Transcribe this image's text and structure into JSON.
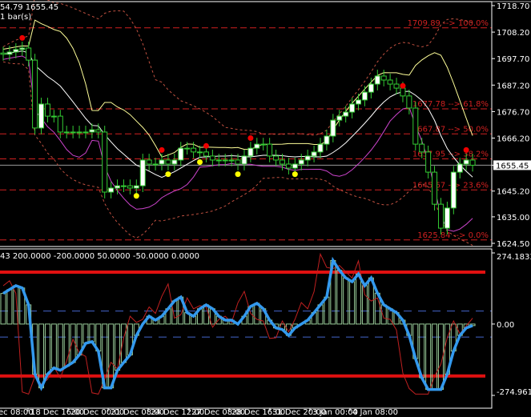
{
  "header": {
    "ohlc_text": "54.79 1655.45",
    "bars_text": "1 bar(s)"
  },
  "indicator_header": {
    "text": "43 200.0000 -200.0000 50.0000 -50.0000 0.0000"
  },
  "colors": {
    "bull_body": "#ffffff",
    "candle_outline": "#33cc33",
    "fib": "#d02020",
    "osc": "#3399ee",
    "level": "#e01010",
    "mid_band": "#ffffff",
    "upper_band": "#ffff99",
    "lower_band": "#cc44cc"
  },
  "chart_data": [
    {
      "type": "candlestick",
      "title": "",
      "ylim": [
        1624.5,
        1718.7
      ],
      "price_ticks": [
        "1718.70",
        "1708.20",
        "1697.70",
        "1687.20",
        "1676.70",
        "1666.20",
        "1655.45",
        "1645.20",
        "1635.00",
        "1624.50"
      ],
      "price_tick_values": [
        1718.7,
        1708.2,
        1697.7,
        1687.2,
        1676.7,
        1666.2,
        1655.45,
        1645.2,
        1635.0,
        1624.5
      ],
      "current_price": "1655.45",
      "closes": [
        1699.4,
        1700.3,
        1701.3,
        1701.9,
        1697.1,
        1670.2,
        1679.7,
        1674.9,
        1674.9,
        1668.6,
        1668.6,
        1668.6,
        1668.6,
        1668.6,
        1669.5,
        1668.6,
        1644.8,
        1646.4,
        1647.3,
        1647.3,
        1646.4,
        1647.3,
        1657.5,
        1655.9,
        1655.9,
        1657.5,
        1655.9,
        1657.5,
        1662.2,
        1662.2,
        1660.7,
        1660.7,
        1659.1,
        1657.5,
        1657.5,
        1657.5,
        1657.5,
        1655.9,
        1659.1,
        1662.2,
        1663.8,
        1663.8,
        1659.1,
        1657.5,
        1655.9,
        1654.3,
        1655.9,
        1657.5,
        1659.1,
        1660.7,
        1663.8,
        1667.0,
        1673.3,
        1674.9,
        1676.5,
        1679.7,
        1681.3,
        1684.4,
        1687.6,
        1690.8,
        1689.2,
        1687.6,
        1686.0,
        1682.9,
        1678.1,
        1663.8,
        1660.7,
        1652.7,
        1640.0,
        1630.5,
        1638.5,
        1652.7,
        1655.9,
        1657.5,
        1655.45
      ],
      "fib_levels": [
        {
          "price": 1709.89,
          "label": "1709.89 --> 100.0%"
        },
        {
          "price": 1677.78,
          "label": "1677.78 --> 61.8%"
        },
        {
          "price": 1667.87,
          "label": "1667.87 --> 50.0%"
        },
        {
          "price": 1657.95,
          "label": "1657.95 --> 38.2%"
        },
        {
          "price": 1645.67,
          "label": "1645.67 --> 23.6%"
        },
        {
          "price": 1625.84,
          "label": "1625.84 --> 0.0%"
        }
      ],
      "red_markers": [
        3,
        25,
        32,
        39,
        63,
        73
      ],
      "yellow_markers": [
        21,
        26,
        31,
        37,
        46
      ]
    },
    {
      "type": "line",
      "ylim": [
        -274.961,
        274.1833
      ],
      "axis_labels": [
        "274.1833",
        "0.00",
        "-274.961"
      ],
      "axis_values": [
        274.1833,
        0,
        -274.961
      ],
      "levels": [
        200,
        -200,
        50,
        -50,
        0
      ],
      "values": [
        118,
        133,
        148,
        139,
        74,
        -193,
        -246,
        -193,
        -169,
        -178,
        -163,
        -148,
        -119,
        -74,
        -68,
        -104,
        -246,
        -246,
        -178,
        -148,
        -119,
        -44,
        0,
        30,
        15,
        30,
        59,
        89,
        104,
        44,
        30,
        59,
        74,
        59,
        30,
        15,
        15,
        0,
        30,
        68,
        80,
        59,
        15,
        -15,
        -21,
        -44,
        -15,
        0,
        15,
        44,
        74,
        104,
        245,
        207,
        178,
        163,
        193,
        148,
        178,
        119,
        74,
        59,
        44,
        15,
        -44,
        -133,
        -207,
        -252,
        -252,
        -252,
        -193,
        -104,
        -44,
        -15,
        -6
      ]
    }
  ],
  "time_axis": {
    "labels": [
      "ec 08:00",
      "18 Dec 16:00",
      "20 Dec 00:00",
      "21 Dec 08:00",
      "24 Dec 12:00",
      "27 Dec 08:00",
      "28 Dec 16:00",
      "31 Dec 20:00",
      "3 Jan 00:00",
      "4 Jan 08:00"
    ]
  }
}
